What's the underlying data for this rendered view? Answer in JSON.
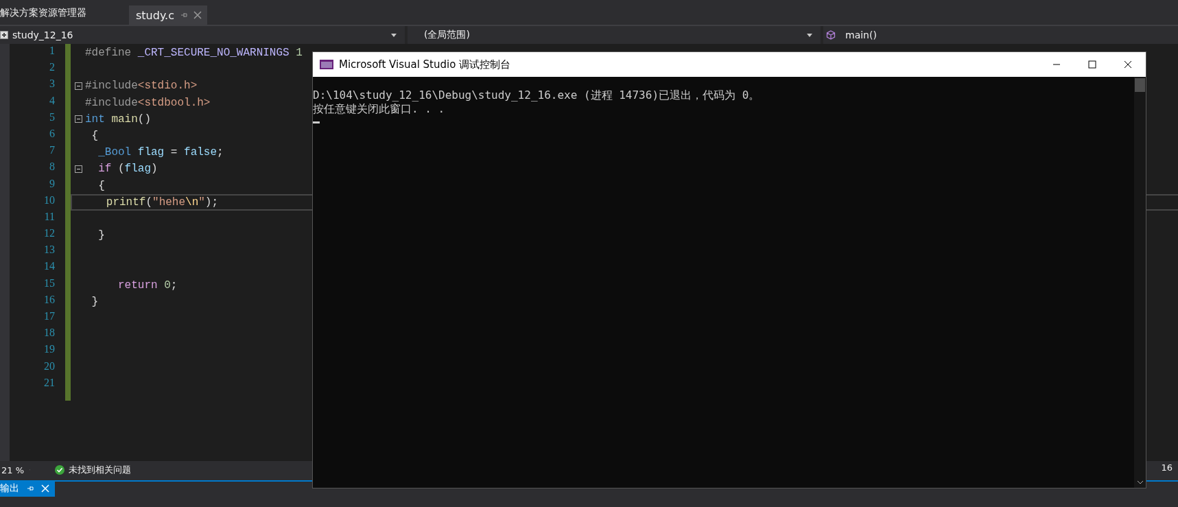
{
  "tabs": {
    "panel_title": "解决方案资源管理器",
    "documents": [
      {
        "label": "study.c",
        "selected": true
      }
    ]
  },
  "nav_bar": {
    "project": "study_12_16",
    "scope": "(全局范围)",
    "member": "main()"
  },
  "editor": {
    "lines": [
      {
        "number": "1",
        "foldable": false,
        "current": false,
        "tokens": [
          {
            "text": "#define ",
            "kind": "directive"
          },
          {
            "text": "_CRT_SECURE_NO_WARNINGS",
            "kind": "macro"
          },
          {
            "text": " 1",
            "kind": "number"
          }
        ]
      },
      {
        "number": "2",
        "foldable": false,
        "current": false
      },
      {
        "number": "3",
        "foldable": true,
        "current": false,
        "tokens": [
          {
            "text": "#include",
            "kind": "directive"
          },
          {
            "text": "<stdio.h>",
            "kind": "string"
          }
        ]
      },
      {
        "number": "4",
        "foldable": false,
        "current": false,
        "tokens": [
          {
            "text": "#include",
            "kind": "directive"
          },
          {
            "text": "<stdbool.h>",
            "kind": "string"
          }
        ]
      },
      {
        "number": "5",
        "foldable": true,
        "current": false,
        "tokens": [
          {
            "text": "int ",
            "kind": "keyword"
          },
          {
            "text": "main",
            "kind": "function"
          },
          {
            "text": "()",
            "kind": "plain"
          }
        ]
      },
      {
        "number": "6",
        "foldable": false,
        "current": false,
        "tokens": [
          {
            "text": " {",
            "kind": "plain"
          }
        ]
      },
      {
        "number": "7",
        "foldable": false,
        "current": false,
        "tokens": [
          {
            "text": "  _Bool ",
            "kind": "keyword"
          },
          {
            "text": "flag",
            "kind": "variable"
          },
          {
            "text": " = ",
            "kind": "plain"
          },
          {
            "text": "false",
            "kind": "variable"
          },
          {
            "text": ";",
            "kind": "plain"
          }
        ]
      },
      {
        "number": "8",
        "foldable": true,
        "current": false,
        "tokens": [
          {
            "text": "  if",
            "kind": "control"
          },
          {
            "text": " (",
            "kind": "plain"
          },
          {
            "text": "flag",
            "kind": "variable"
          },
          {
            "text": ")",
            "kind": "plain"
          }
        ]
      },
      {
        "number": "9",
        "foldable": false,
        "current": false,
        "tokens": [
          {
            "text": "  {",
            "kind": "plain"
          }
        ]
      },
      {
        "number": "10",
        "foldable": false,
        "current": true,
        "tokens": [
          {
            "text": "   printf",
            "kind": "function"
          },
          {
            "text": "(",
            "kind": "plain"
          },
          {
            "text": "\"hehe",
            "kind": "string"
          },
          {
            "text": "\\n",
            "kind": "escape"
          },
          {
            "text": "\"",
            "kind": "string"
          },
          {
            "text": ");",
            "kind": "plain"
          }
        ]
      },
      {
        "number": "11",
        "foldable": false,
        "current": false
      },
      {
        "number": "12",
        "foldable": false,
        "current": false,
        "tokens": [
          {
            "text": "  }",
            "kind": "plain"
          }
        ]
      },
      {
        "number": "13",
        "foldable": false,
        "current": false
      },
      {
        "number": "14",
        "foldable": false,
        "current": false
      },
      {
        "number": "15",
        "foldable": false,
        "current": false,
        "tokens": [
          {
            "text": "     return",
            "kind": "control"
          },
          {
            "text": " 0",
            "kind": "number"
          },
          {
            "text": ";",
            "kind": "plain"
          }
        ]
      },
      {
        "number": "16",
        "foldable": false,
        "current": false,
        "tokens": [
          {
            "text": " }",
            "kind": "plain"
          }
        ]
      },
      {
        "number": "17",
        "foldable": false,
        "current": false
      },
      {
        "number": "18",
        "foldable": false,
        "current": false
      },
      {
        "number": "19",
        "foldable": false,
        "current": false
      },
      {
        "number": "20",
        "foldable": false,
        "current": false
      },
      {
        "number": "21",
        "foldable": false,
        "current": false
      }
    ]
  },
  "status_strip": {
    "zoom": "21 %",
    "issues": "未找到相关问题",
    "column": "16"
  },
  "bottom_panel": {
    "tabs": [
      {
        "label": "输出",
        "selected": true
      }
    ]
  },
  "console_window": {
    "title": "Microsoft Visual Studio 调试控制台",
    "lines": [
      "D:\\104\\study_12_16\\Debug\\study_12_16.exe (进程 14736)已退出，代码为 0。",
      "按任意键关闭此窗口. . ."
    ]
  }
}
